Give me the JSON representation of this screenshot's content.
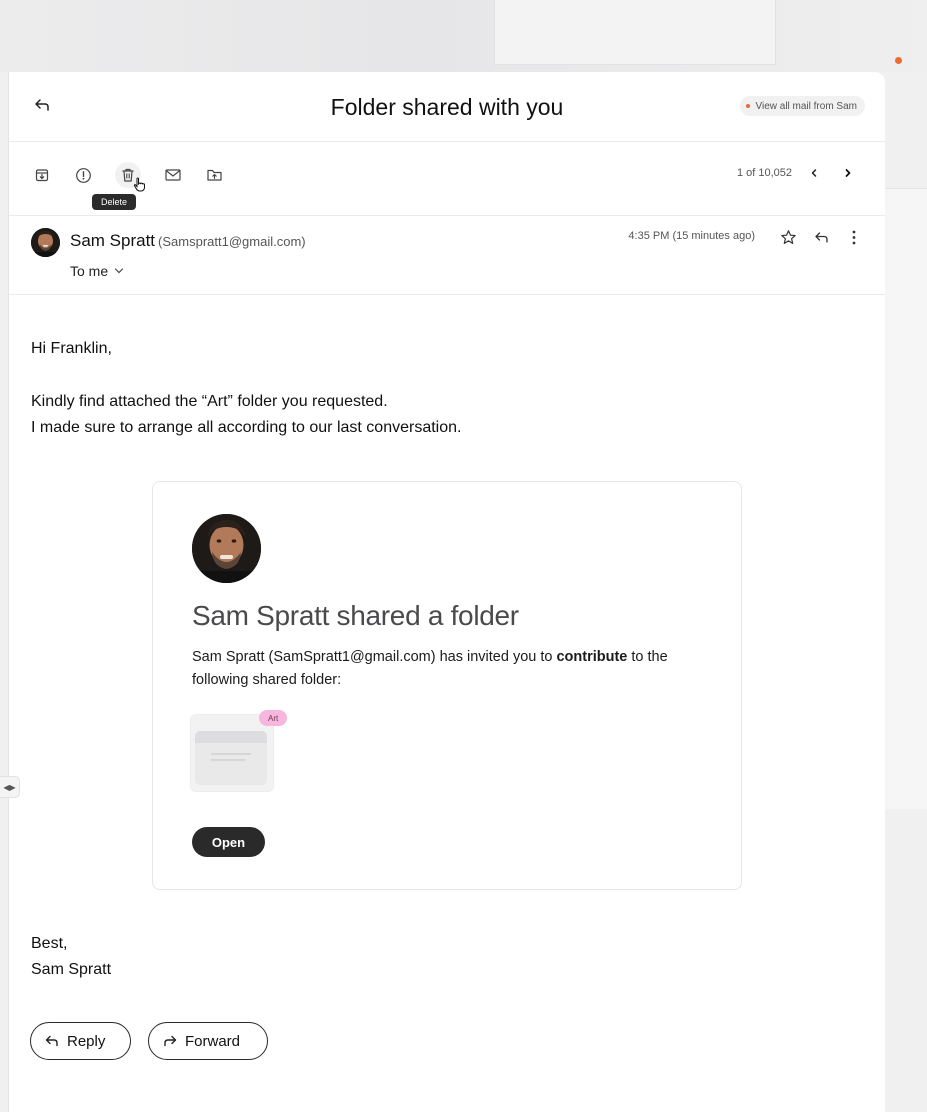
{
  "header": {
    "title": "Folder shared with you",
    "view_all_label": "View all mail from Sam"
  },
  "toolbar": {
    "icons": [
      "archive-icon",
      "report-icon",
      "trash-icon",
      "mail-icon",
      "move-to-folder-icon"
    ],
    "tooltip": "Delete",
    "pager_text": "1 of 10,052"
  },
  "email": {
    "sender_name": "Sam Spratt",
    "sender_email": "(Samspratt1@gmail.com)",
    "to_label": "To me",
    "time": "4:35 PM (15 minutes ago)",
    "greeting": "Hi Franklin,",
    "line1": "Kindly find attached the “Art” folder you requested.",
    "line2": "I made sure to arrange all according to our last conversation.",
    "signoff": "Best,",
    "signature": "Sam Spratt"
  },
  "share_card": {
    "title": "Sam Spratt shared a folder",
    "desc_prefix": "Sam Spratt (SamSpratt1@gmail.com) has invited you to ",
    "desc_bold": "contribute",
    "desc_suffix": " to the following shared folder:",
    "folder_tag": "Art",
    "open_label": "Open"
  },
  "actions": {
    "reply_label": "Reply",
    "forward_label": "Forward"
  },
  "colors": {
    "accent_orange": "#ec6a33",
    "folder_tag_pink": "#f7b6dd",
    "button_dark": "#2a2a2b"
  }
}
